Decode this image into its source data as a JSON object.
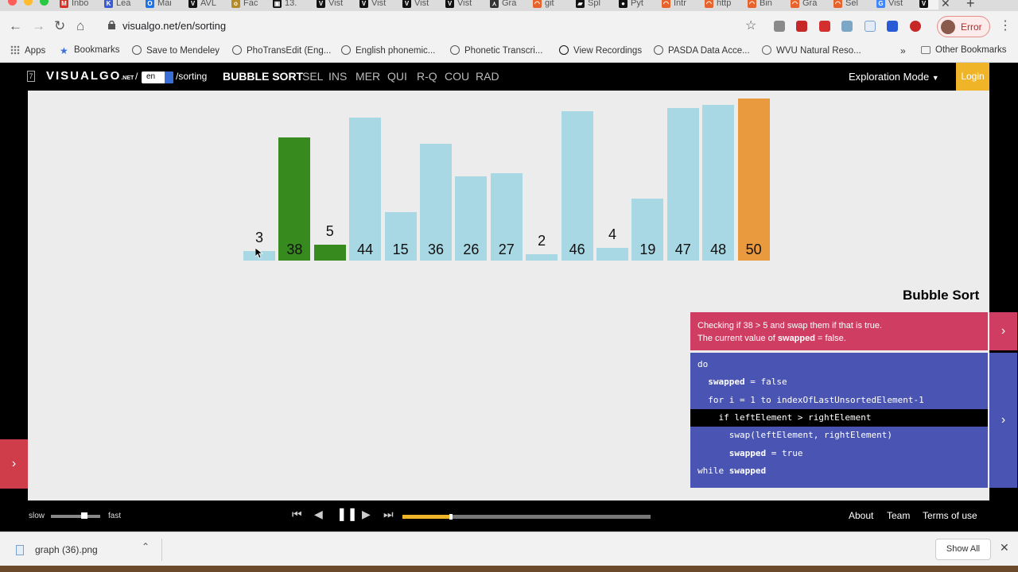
{
  "browser": {
    "tabs": [
      {
        "label": "Inbo",
        "fav_color": "#d93025",
        "fav_char": "M"
      },
      {
        "label": "Lea",
        "fav_color": "#3b5bd6",
        "fav_char": "K"
      },
      {
        "label": "Mai",
        "fav_color": "#1a73e8",
        "fav_char": "O"
      },
      {
        "label": "AVL",
        "fav_color": "#111111",
        "fav_char": "V"
      },
      {
        "label": "Fac",
        "fav_color": "#b58b28",
        "fav_char": "o"
      },
      {
        "label": "13.",
        "fav_color": "#111111",
        "fav_char": "▣"
      },
      {
        "label": "Vist",
        "fav_color": "#111111",
        "fav_char": "V"
      },
      {
        "label": "Vist",
        "fav_color": "#111111",
        "fav_char": "V"
      },
      {
        "label": "Vist",
        "fav_color": "#111111",
        "fav_char": "V"
      },
      {
        "label": "Vist",
        "fav_color": "#111111",
        "fav_char": "V"
      },
      {
        "label": "Gra",
        "fav_color": "#333333",
        "fav_char": "⋏"
      },
      {
        "label": "git",
        "fav_color": "#e8622c",
        "fav_char": "◠"
      },
      {
        "label": "Spl",
        "fav_color": "#111111",
        "fav_char": "▰"
      },
      {
        "label": "Pyt",
        "fav_color": "#111111",
        "fav_char": "●"
      },
      {
        "label": "Intr",
        "fav_color": "#e8622c",
        "fav_char": "◠"
      },
      {
        "label": "http",
        "fav_color": "#e8622c",
        "fav_char": "◠"
      },
      {
        "label": "Bin",
        "fav_color": "#e8622c",
        "fav_char": "◠"
      },
      {
        "label": "Gra",
        "fav_color": "#e8622c",
        "fav_char": "◠"
      },
      {
        "label": "Sel",
        "fav_color": "#e8622c",
        "fav_char": "◠"
      },
      {
        "label": "Vist",
        "fav_color": "#4285f4",
        "fav_char": "G"
      },
      {
        "label": "",
        "fav_color": "#111111",
        "fav_char": "V"
      }
    ],
    "url": "visualgo.net/en/sorting",
    "profile_status": "Error",
    "bookmarks": [
      {
        "label": "Apps",
        "icon": "apps-grid-icon"
      },
      {
        "label": "Bookmarks",
        "icon": "star-icon"
      },
      {
        "label": "Save to Mendeley",
        "icon": "globe-icon"
      },
      {
        "label": "PhoTransEdit (Eng...",
        "icon": "globe-icon"
      },
      {
        "label": "English phonemic...",
        "icon": "globe-icon"
      },
      {
        "label": "Phonetic Transcri...",
        "icon": "globe-icon"
      },
      {
        "label": "View Recordings",
        "icon": "dollar-circle-icon"
      },
      {
        "label": "PASDA Data Acce...",
        "icon": "globe-icon"
      },
      {
        "label": "WVU Natural Reso...",
        "icon": "bird-icon"
      }
    ],
    "other_bookmarks": "Other Bookmarks"
  },
  "header": {
    "logo_main": "VISUALGO",
    "logo_suffix": ".NET",
    "lang": "en",
    "path": "/sorting",
    "algos": [
      "BUBBLE SORT",
      "SEL",
      "INS",
      "MER",
      "QUI",
      "R-Q",
      "COU",
      "RAD"
    ],
    "active_algo": "BUBBLE SORT",
    "mode": "Exploration Mode",
    "login": "Login"
  },
  "visualization": {
    "values": [
      3,
      38,
      5,
      44,
      15,
      36,
      26,
      27,
      2,
      46,
      4,
      19,
      47,
      48,
      50
    ],
    "colors": {
      "default": "#a8d8e4",
      "compared": "#368a1e",
      "sorted": "#ea9a3e"
    },
    "states": [
      "default",
      "compared",
      "compared",
      "default",
      "default",
      "default",
      "default",
      "default",
      "default",
      "default",
      "default",
      "default",
      "default",
      "default",
      "sorted"
    ]
  },
  "panel": {
    "title": "Bubble Sort",
    "status_line1": "Checking if 38 > 5 and swap them if that is true.",
    "status_line2_pre": "The current value of ",
    "status_line2_bold": "swapped",
    "status_line2_post": " = false.",
    "code": [
      "do",
      "  swapped = false",
      "  for i = 1 to indexOfLastUnsortedElement-1",
      "    if leftElement > rightElement",
      "      swap(leftElement, rightElement)",
      "      swapped = true",
      "while swapped"
    ],
    "highlighted_line": 3
  },
  "footer": {
    "slow": "slow",
    "fast": "fast",
    "speed_fraction": 0.68,
    "progress_fraction": 0.195,
    "links": [
      "About",
      "Team",
      "Terms of use"
    ]
  },
  "downloads": {
    "file": "graph (36).png",
    "show_all": "Show All"
  }
}
